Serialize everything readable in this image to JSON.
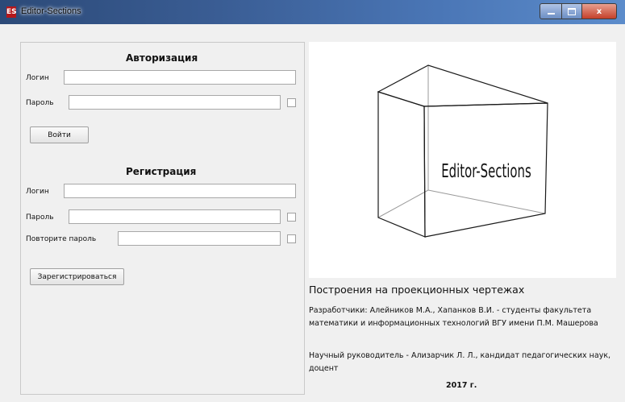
{
  "window": {
    "title": "Editor-Sections",
    "icon_text": "ES",
    "close_glyph": "x"
  },
  "login": {
    "heading": "Авторизация",
    "login_label": "Логин",
    "login_value": "",
    "password_label": "Пароль",
    "password_value": "",
    "submit_label": "Войти"
  },
  "register": {
    "heading": "Регистрация",
    "login_label": "Логин",
    "login_value": "",
    "password_label": "Пароль",
    "password_value": "",
    "repeat_label": "Повторите пароль",
    "repeat_value": "",
    "submit_label": "Зарегистрироваться"
  },
  "logo": {
    "text": "Editor-Sections"
  },
  "info": {
    "title": "Построения на проекционных чертежах",
    "developers": "Разработчики: Алейников М.А., Хапанков В.И. - студенты факультета математики и информационных технологий ВГУ имени П.М. Машерова",
    "supervisor": "Научный руководитель - Ализарчик Л. Л., кандидат педагогических наук, доцент",
    "year": "2017 г."
  }
}
